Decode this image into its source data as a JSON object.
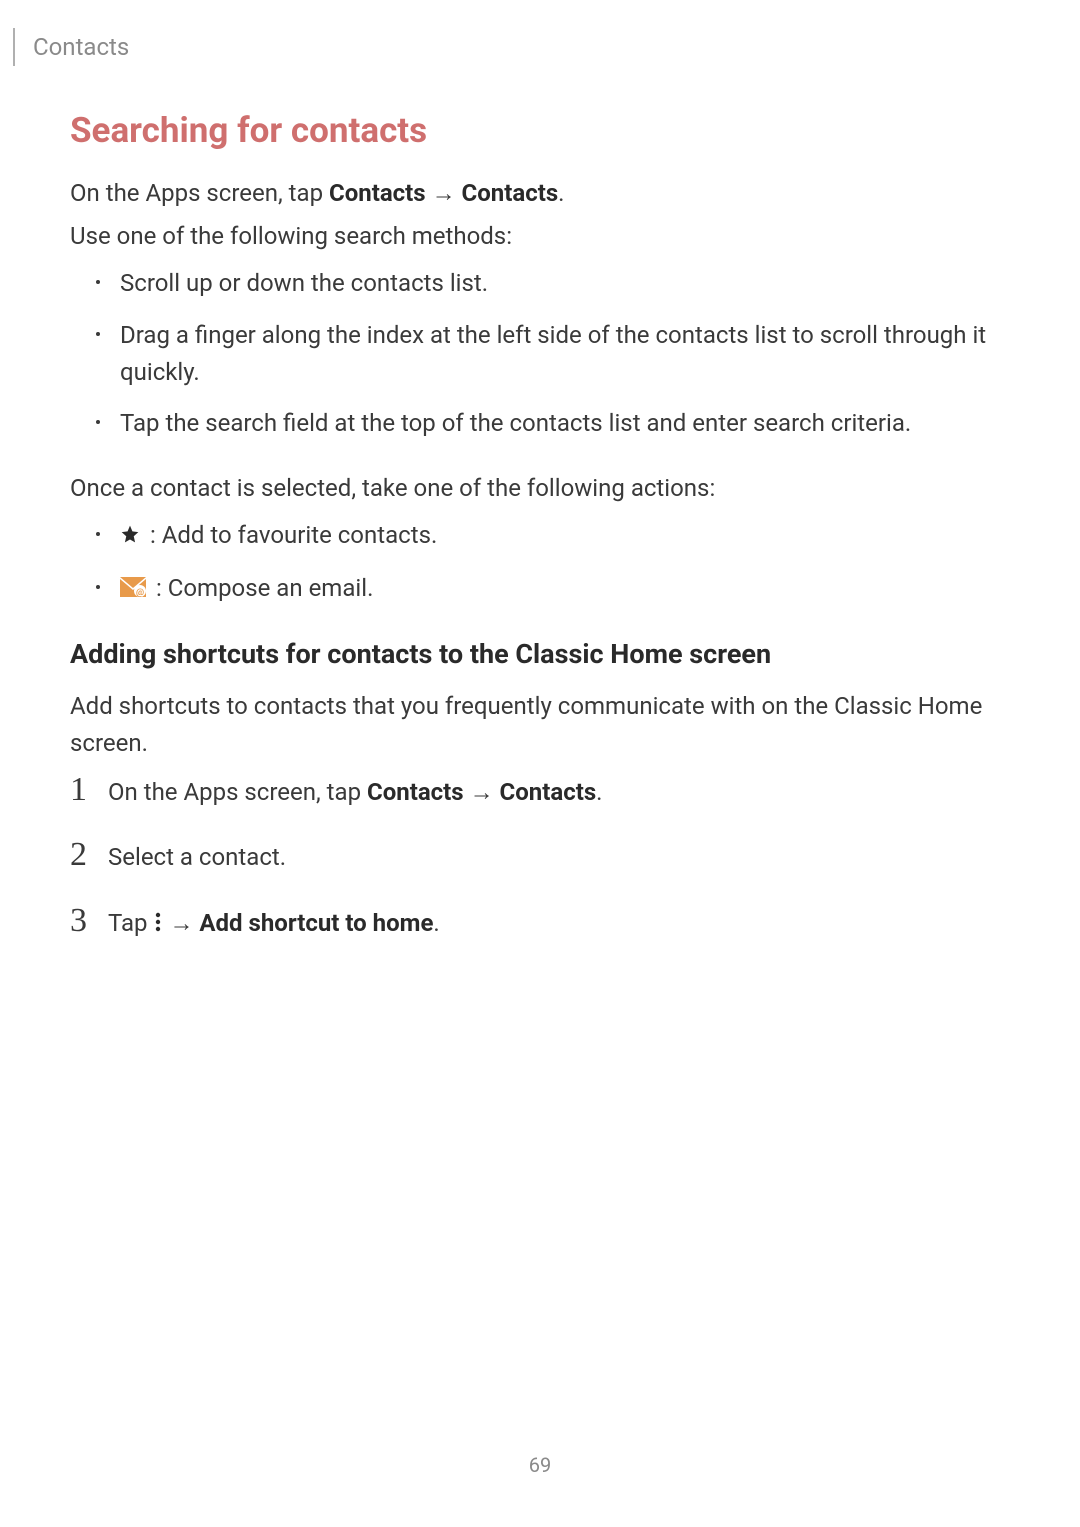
{
  "header": {
    "breadcrumb": "Contacts"
  },
  "section": {
    "title": "Searching for contacts",
    "intro_prefix": "On the Apps screen, tap ",
    "intro_bold1": "Contacts",
    "intro_arrow": " → ",
    "intro_bold2": "Contacts",
    "intro_suffix": ".",
    "methods_intro": "Use one of the following search methods:",
    "bullets": [
      "Scroll up or down the contacts list.",
      "Drag a finger along the index at the left side of the contacts list to scroll through it quickly.",
      "Tap the search field at the top of the contacts list and enter search criteria."
    ],
    "actions_intro": "Once a contact is selected, take one of the following actions:",
    "action_star": " : Add to favourite contacts.",
    "action_email": " : Compose an email."
  },
  "subsection": {
    "title": "Adding shortcuts for contacts to the Classic Home screen",
    "intro": "Add shortcuts to contacts that you frequently communicate with on the Classic Home screen.",
    "steps": {
      "n1": "1",
      "s1_prefix": "On the Apps screen, tap ",
      "s1_b1": "Contacts",
      "s1_arrow": " → ",
      "s1_b2": "Contacts",
      "s1_suffix": ".",
      "n2": "2",
      "s2": "Select a contact.",
      "n3": "3",
      "s3_prefix": "Tap ",
      "s3_arrow": " → ",
      "s3_bold": "Add shortcut to home",
      "s3_suffix": "."
    }
  },
  "page_number": "69"
}
